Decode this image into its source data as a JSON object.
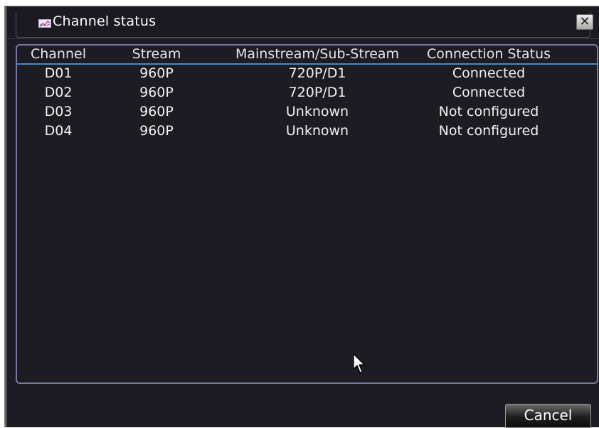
{
  "dialog": {
    "title": "Channel status",
    "title_icon": "status-chart-icon",
    "close_icon": "close-icon",
    "close_glyph": "✕"
  },
  "table": {
    "headers": [
      "Channel",
      "Stream",
      "Mainstream/Sub-Stream",
      "Connection Status"
    ],
    "rows": [
      [
        "D01",
        "960P",
        "720P/D1",
        "Connected"
      ],
      [
        "D02",
        "960P",
        "720P/D1",
        "Connected"
      ],
      [
        "D03",
        "960P",
        "Unknown",
        "Not configured"
      ],
      [
        "D04",
        "960P",
        "Unknown",
        "Not configured"
      ]
    ]
  },
  "footer": {
    "cancel_label": "Cancel"
  },
  "colors": {
    "background": "#1c1c22",
    "panel_border": "#7a7aa8",
    "header_rule": "#4c88c8",
    "text": "#f2f2f2"
  }
}
